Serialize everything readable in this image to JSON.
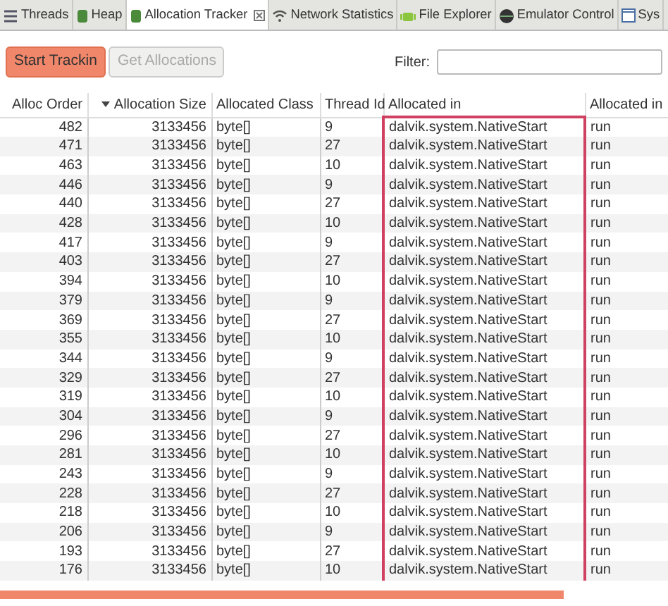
{
  "tabs": [
    {
      "label": "Threads",
      "selected": false
    },
    {
      "label": "Heap",
      "selected": false
    },
    {
      "label": "Allocation Tracker",
      "selected": true
    },
    {
      "label": "Network Statistics",
      "selected": false
    },
    {
      "label": "File Explorer",
      "selected": false
    },
    {
      "label": "Emulator Control",
      "selected": false
    },
    {
      "label": "Sys",
      "selected": false
    }
  ],
  "toolbar": {
    "buttons": [
      {
        "label": "Start Trackin",
        "disabled": false,
        "highlighted": true
      },
      {
        "label": "Get Allocations",
        "disabled": true,
        "highlighted": false
      }
    ],
    "filter": {
      "label": "Filter:"
    }
  },
  "table": {
    "columns": [
      {
        "label": "Alloc Order",
        "sorted": false,
        "highlighted": false
      },
      {
        "label": "Allocation Size",
        "sorted": true,
        "highlighted": false
      },
      {
        "label": "Allocated Class",
        "sorted": false,
        "highlighted": false
      },
      {
        "label": "Thread Id",
        "sorted": false,
        "highlighted": false
      },
      {
        "label": "Allocated in",
        "sorted": false,
        "highlighted": true
      },
      {
        "label": "Allocated in",
        "sorted": false,
        "highlighted": false
      }
    ],
    "rows": [
      [
        "482",
        "3133456",
        "byte[]",
        "9",
        "dalvik.system.NativeStart",
        "run"
      ],
      [
        "471",
        "3133456",
        "byte[]",
        "27",
        "dalvik.system.NativeStart",
        "run"
      ],
      [
        "463",
        "3133456",
        "byte[]",
        "10",
        "dalvik.system.NativeStart",
        "run"
      ],
      [
        "446",
        "3133456",
        "byte[]",
        "9",
        "dalvik.system.NativeStart",
        "run"
      ],
      [
        "440",
        "3133456",
        "byte[]",
        "27",
        "dalvik.system.NativeStart",
        "run"
      ],
      [
        "428",
        "3133456",
        "byte[]",
        "10",
        "dalvik.system.NativeStart",
        "run"
      ],
      [
        "417",
        "3133456",
        "byte[]",
        "9",
        "dalvik.system.NativeStart",
        "run"
      ],
      [
        "403",
        "3133456",
        "byte[]",
        "27",
        "dalvik.system.NativeStart",
        "run"
      ],
      [
        "394",
        "3133456",
        "byte[]",
        "10",
        "dalvik.system.NativeStart",
        "run"
      ],
      [
        "379",
        "3133456",
        "byte[]",
        "9",
        "dalvik.system.NativeStart",
        "run"
      ],
      [
        "369",
        "3133456",
        "byte[]",
        "27",
        "dalvik.system.NativeStart",
        "run"
      ],
      [
        "355",
        "3133456",
        "byte[]",
        "10",
        "dalvik.system.NativeStart",
        "run"
      ],
      [
        "344",
        "3133456",
        "byte[]",
        "9",
        "dalvik.system.NativeStart",
        "run"
      ],
      [
        "329",
        "3133456",
        "byte[]",
        "27",
        "dalvik.system.NativeStart",
        "run"
      ],
      [
        "319",
        "3133456",
        "byte[]",
        "10",
        "dalvik.system.NativeStart",
        "run"
      ],
      [
        "304",
        "3133456",
        "byte[]",
        "9",
        "dalvik.system.NativeStart",
        "run"
      ],
      [
        "296",
        "3133456",
        "byte[]",
        "27",
        "dalvik.system.NativeStart",
        "run"
      ],
      [
        "281",
        "3133456",
        "byte[]",
        "10",
        "dalvik.system.NativeStart",
        "run"
      ],
      [
        "243",
        "3133456",
        "byte[]",
        "9",
        "dalvik.system.NativeStart",
        "run"
      ],
      [
        "228",
        "3133456",
        "byte[]",
        "27",
        "dalvik.system.NativeStart",
        "run"
      ],
      [
        "218",
        "3133456",
        "byte[]",
        "10",
        "dalvik.system.NativeStart",
        "run"
      ],
      [
        "206",
        "3133456",
        "byte[]",
        "9",
        "dalvik.system.NativeStart",
        "run"
      ],
      [
        "193",
        "3133456",
        "byte[]",
        "27",
        "dalvik.system.NativeStart",
        "run"
      ],
      [
        "176",
        "3133456",
        "byte[]",
        "10",
        "dalvik.system.NativeStart",
        "run"
      ]
    ]
  }
}
